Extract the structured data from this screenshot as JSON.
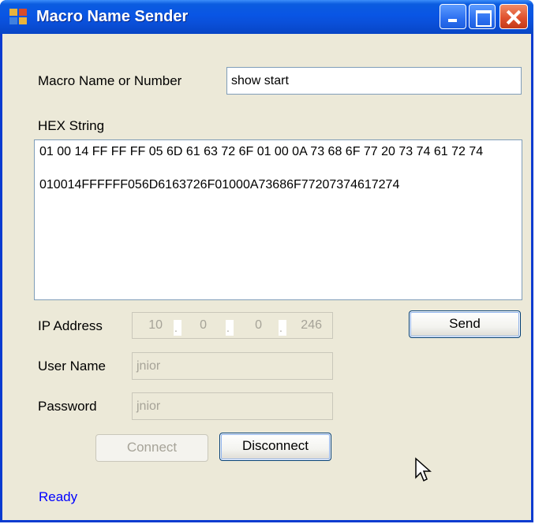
{
  "window": {
    "title": "Macro Name Sender",
    "title_color": "#0a4fd8"
  },
  "macro": {
    "label": "Macro Name or Number",
    "value": "show start"
  },
  "hex": {
    "label": "HEX String",
    "value": "01 00 14 FF FF FF 05 6D 61 63 72 6F 01 00 0A 73 68 6F 77 20 73 74 61 72 74\n\n010014FFFFFF056D6163726F01000A73686F77207374617274"
  },
  "ip": {
    "label": "IP Address",
    "octets": [
      "10",
      "0",
      "0",
      "246"
    ],
    "separator": "."
  },
  "username": {
    "label": "User Name",
    "value": "jnior"
  },
  "password": {
    "label": "Password",
    "value": "jnior"
  },
  "buttons": {
    "send": "Send",
    "connect": "Connect",
    "disconnect": "Disconnect"
  },
  "status": {
    "text": "Ready",
    "color": "#0000ff"
  },
  "icons": {
    "app": "app-icon",
    "minimize": "minimize-icon",
    "maximize": "maximize-icon",
    "close": "close-icon",
    "cursor": "mouse-cursor-icon"
  }
}
